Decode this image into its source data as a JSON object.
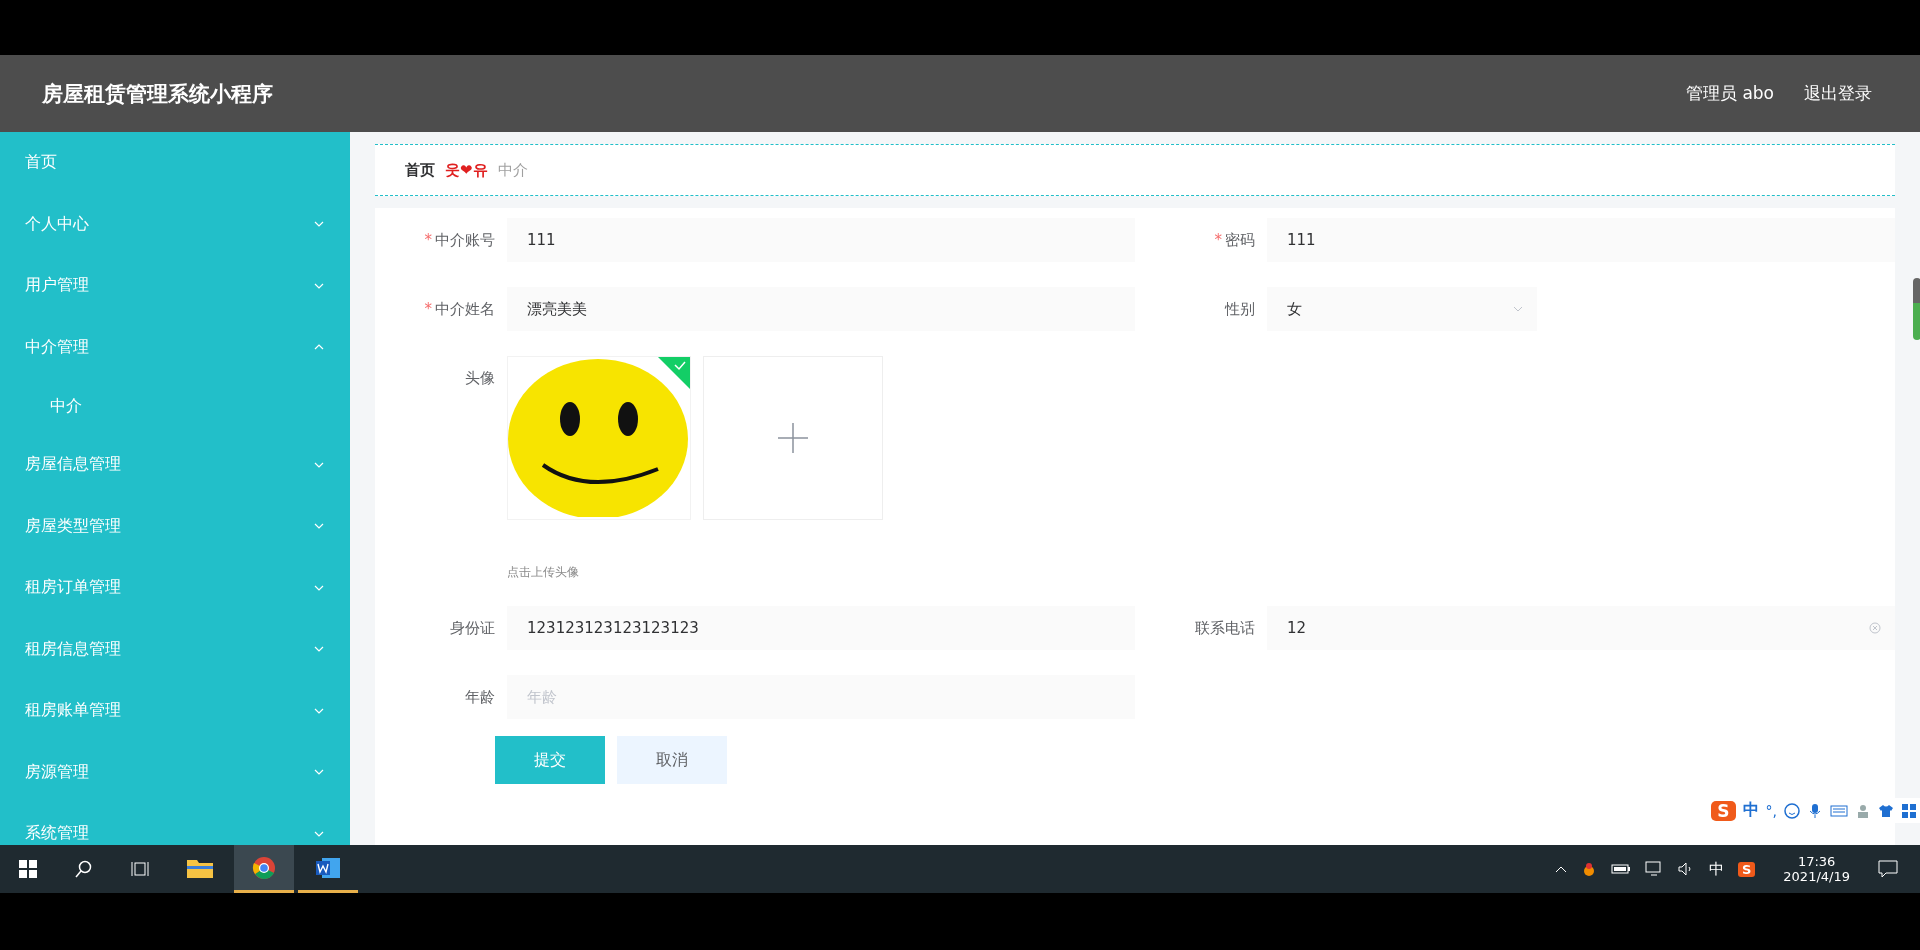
{
  "header": {
    "title": "房屋租赁管理系统小程序",
    "user": "管理员 abo",
    "logout": "退出登录"
  },
  "sidebar": {
    "items": [
      {
        "label": "首页",
        "kind": "link"
      },
      {
        "label": "个人中心",
        "kind": "group",
        "expanded": false
      },
      {
        "label": "用户管理",
        "kind": "group",
        "expanded": false
      },
      {
        "label": "中介管理",
        "kind": "group",
        "expanded": true,
        "children": [
          {
            "label": "中介"
          }
        ]
      },
      {
        "label": "房屋信息管理",
        "kind": "group",
        "expanded": false
      },
      {
        "label": "房屋类型管理",
        "kind": "group",
        "expanded": false
      },
      {
        "label": "租房订单管理",
        "kind": "group",
        "expanded": false
      },
      {
        "label": "租房信息管理",
        "kind": "group",
        "expanded": false
      },
      {
        "label": "租房账单管理",
        "kind": "group",
        "expanded": false
      },
      {
        "label": "房源管理",
        "kind": "group",
        "expanded": false
      },
      {
        "label": "系统管理",
        "kind": "group",
        "expanded": false
      }
    ]
  },
  "breadcrumb": {
    "home": "首页",
    "separator": "웃❤유",
    "current": "中介"
  },
  "form": {
    "rows": [
      [
        {
          "label": "中介账号",
          "kind": "text",
          "required": true,
          "value": "111"
        },
        {
          "label": "密码",
          "kind": "text",
          "required": true,
          "value": "111"
        }
      ],
      [
        {
          "label": "中介姓名",
          "kind": "text",
          "required": true,
          "value": "漂亮美美"
        },
        {
          "label": "性别",
          "kind": "select",
          "required": false,
          "value": "女"
        }
      ],
      [
        {
          "label": "头像",
          "kind": "upload",
          "required": false,
          "hint": "点击上传头像",
          "uploaded": true
        }
      ],
      [
        {
          "label": "身份证",
          "kind": "text",
          "required": false,
          "value": "123123123123123123"
        },
        {
          "label": "联系电话",
          "kind": "text",
          "required": false,
          "value": "12",
          "clearable": true
        }
      ],
      [
        {
          "label": "年龄",
          "kind": "text",
          "required": false,
          "placeholder": "年龄"
        }
      ]
    ],
    "required_mark": "*",
    "buttons": [
      {
        "label": "提交",
        "kind": "primary"
      },
      {
        "label": "取消",
        "kind": "plain"
      }
    ]
  },
  "ime_bar": {
    "logo": "S",
    "mode": "中",
    "punct": "°,"
  },
  "taskbar": {
    "apps": [
      {
        "kind": "explorer",
        "selected": false
      },
      {
        "kind": "chrome",
        "selected": true
      },
      {
        "kind": "word",
        "selected": false
      }
    ],
    "ime": "中",
    "tray_logo": "S",
    "time": "17:36",
    "date": "2021/4/19"
  }
}
